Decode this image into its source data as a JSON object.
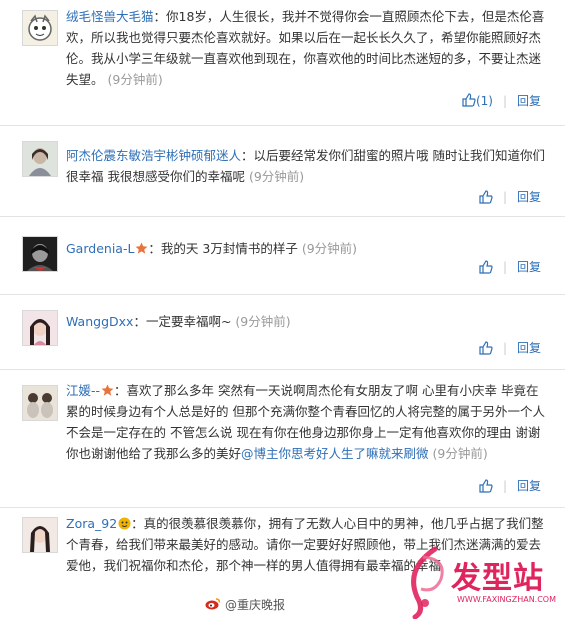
{
  "comments": [
    {
      "user": "绒毛怪兽大毛猫",
      "text": "：你18岁，人生很长，我并不觉得你会一直照顾杰伦下去，但是杰伦喜欢，所以我也觉得只要杰伦喜欢就好。如果以后在一起长长久久了，希望你能照顾好杰伦。我从小学三年级就一直喜欢他到现在，你喜欢他的时间比杰迷短的多，不要让杰迷失望。",
      "time": "(9分钟前)",
      "like_label": "(1)",
      "reply_label": "回复"
    },
    {
      "user": "阿杰伦震东敏浩宇彬钟硕郁迷人",
      "text": "：以后要经常发你们甜蜜的照片哦 随时让我们知道你们很幸福 我很想感受你们的幸福呢",
      "time": "(9分钟前)",
      "reply_label": "回复"
    },
    {
      "user": "Gardenia-L",
      "text": "：我的天 3万封情书的样子",
      "time": "(9分钟前)",
      "reply_label": "回复"
    },
    {
      "user": "WanggDxx",
      "text": "：一定要幸福啊~",
      "time": "(9分钟前)",
      "reply_label": "回复"
    },
    {
      "user": "江媛--",
      "text": "：喜欢了那么多年 突然有一天说啊周杰伦有女朋友了啊 心里有小庆幸 毕竟在累的时候身边有个人总是好的 但那个充满你整个青春回忆的人将完整的属于另外一个人不会是一定存在的 不管怎么说 现在有你在他身边那你身上一定有他喜欢你的理由 谢谢你也谢谢他给了我那么多的美好",
      "mention": "@博主你思考好人生了嘛就来刷微",
      "time": "(9分钟前)",
      "reply_label": "回复"
    },
    {
      "user": "Zora_92",
      "text": "：真的很羡慕很羡慕你，拥有了无数人心目中的男神，他几乎占据了我们整个青春，给我们带来最美好的感动。请你一定要好好照顾他，带上我们杰迷满满的爱去爱他，我们祝福你和杰伦，那个神一样的男人值得拥有最幸福的幸福"
    }
  ],
  "watermark": {
    "logo_text": "发型站",
    "logo_url": "WWW.FAXINGZHAN.COM",
    "weibo_text": "@重庆晚报"
  },
  "colors": {
    "link": "#2e6fb7",
    "muted": "#999999",
    "logo_red": "#e0245e"
  }
}
